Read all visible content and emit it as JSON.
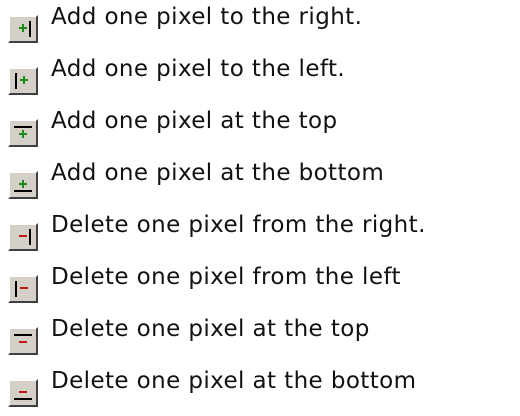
{
  "colors": {
    "add_glyph": "#1a8a1a",
    "delete_glyph": "#c01818",
    "bar": "#000000",
    "button_face": "#d4d0c8"
  },
  "items": [
    {
      "icon": "add-pixel-right-icon",
      "label": "Add one pixel to the right."
    },
    {
      "icon": "add-pixel-left-icon",
      "label": "Add one pixel to the left."
    },
    {
      "icon": "add-pixel-top-icon",
      "label": "Add one pixel at the top"
    },
    {
      "icon": "add-pixel-bottom-icon",
      "label": "Add one pixel at the bottom"
    },
    {
      "icon": "delete-pixel-right-icon",
      "label": "Delete one pixel from the right."
    },
    {
      "icon": "delete-pixel-left-icon",
      "label": "Delete one pixel from the left"
    },
    {
      "icon": "delete-pixel-top-icon",
      "label": "Delete one pixel at the top"
    },
    {
      "icon": "delete-pixel-bottom-icon",
      "label": "Delete one pixel at the bottom"
    }
  ]
}
